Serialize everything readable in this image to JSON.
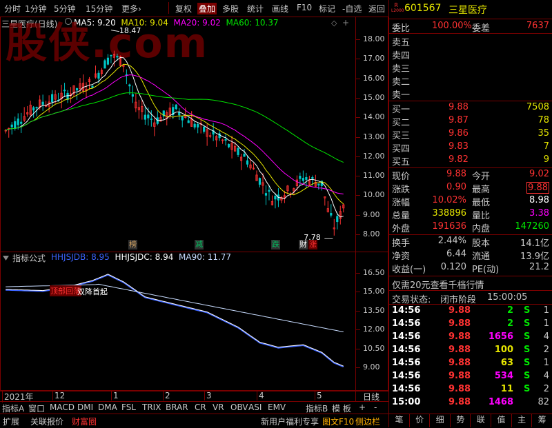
{
  "toolbar": {
    "left": [
      "分时",
      "1分钟",
      "5分钟",
      "15分钟",
      "更多"
    ],
    "more_arrow": "›",
    "right": [
      "复权",
      "叠加",
      "多股",
      "统计",
      "画线",
      "F10",
      "标记",
      "-自选",
      "返回"
    ],
    "active": "叠加"
  },
  "main_chart": {
    "stock_label": "三星医疗(日线)",
    "ma": [
      {
        "label": "MA5: 9.20",
        "color": "#ffffff"
      },
      {
        "label": "MA10: 9.04",
        "color": "#e6e600"
      },
      {
        "label": "MA20: 9.02",
        "color": "#ff00ff"
      },
      {
        "label": "MA60: 10.37",
        "color": "#00e600"
      }
    ],
    "y_ticks": [
      "18.00",
      "17.00",
      "16.00",
      "15.00",
      "14.00",
      "13.00",
      "12.00",
      "11.00",
      "10.00",
      "9.00",
      "8.00"
    ],
    "high_label": "18.47",
    "low_label": "7.78",
    "markers": [
      {
        "text": "榜",
        "color": "#d0a060"
      },
      {
        "text": "减",
        "color": "#00c060"
      },
      {
        "text": "跌",
        "color": "#00c060"
      },
      {
        "text": "财",
        "color": "#ffffff"
      },
      {
        "text": "涨",
        "color": "#ff3232"
      }
    ],
    "watermark": "股侠.com"
  },
  "indicator": {
    "title": "指标公式",
    "items": [
      {
        "label": "HHJSJDB: 8.95",
        "color": "#3c64ff"
      },
      {
        "label": "HHJSJDC: 8.94",
        "color": "#ffffff"
      },
      {
        "label": "MA90: 11.77",
        "color": "#c8dcff"
      }
    ],
    "y_ticks": [
      "16.50",
      "15.00",
      "13.50",
      "12.00",
      "10.50",
      "9.00"
    ],
    "signals": [
      "顶部回落",
      "双降首起"
    ]
  },
  "x_axis": {
    "labels": [
      "2021年",
      "12",
      "1",
      "2",
      "3",
      "4",
      "5"
    ],
    "period": "日线"
  },
  "bottom_tabs": [
    "指标A",
    "窗口",
    "MACD",
    "DMI",
    "DMA",
    "FSL",
    "TRIX",
    "BRAR",
    "CR",
    "VR",
    "OBV",
    "ASI",
    "EMV"
  ],
  "bottom_tabs_right": [
    "指标B",
    "模 板",
    "+",
    "-"
  ],
  "bottom_bar": {
    "left": [
      "扩展",
      "关联报价",
      "财富圈"
    ],
    "right": [
      "新用户福利专享",
      "图文F10",
      "侧边栏"
    ]
  },
  "side_tabs": [
    "笔",
    "价",
    "细",
    "势",
    "联",
    "值",
    "主",
    "筹"
  ],
  "quote": {
    "badge_r": "R",
    "badge_l2": "L2000",
    "code": "601567",
    "name": "三星医疗",
    "weibi_label": "委比",
    "weibi": "100.00%",
    "weicha_label": "委差",
    "weicha": "7637",
    "sell": [
      {
        "label": "卖五"
      },
      {
        "label": "卖四"
      },
      {
        "label": "卖三"
      },
      {
        "label": "卖二"
      },
      {
        "label": "卖一"
      }
    ],
    "buy": [
      {
        "label": "买一",
        "price": "9.88",
        "vol": "7508"
      },
      {
        "label": "买二",
        "price": "9.87",
        "vol": "78"
      },
      {
        "label": "买三",
        "price": "9.86",
        "vol": "35"
      },
      {
        "label": "买四",
        "price": "9.83",
        "vol": "7"
      },
      {
        "label": "买五",
        "price": "9.82",
        "vol": "9"
      }
    ],
    "stats": [
      {
        "l1": "现价",
        "v1": "9.88",
        "c1": "red",
        "l2": "今开",
        "v2": "9.02",
        "c2": "red"
      },
      {
        "l1": "涨跌",
        "v1": "0.90",
        "c1": "red",
        "l2": "最高",
        "v2": "9.88",
        "c2": "red"
      },
      {
        "l1": "涨幅",
        "v1": "10.02%",
        "c1": "red",
        "l2": "最低",
        "v2": "8.98",
        "c2": "wht"
      },
      {
        "l1": "总量",
        "v1": "338896",
        "c1": "yel",
        "l2": "量比",
        "v2": "3.38",
        "c2": "mag"
      },
      {
        "l1": "外盘",
        "v1": "191636",
        "c1": "red",
        "l2": "内盘",
        "v2": "147260",
        "c2": "grn"
      }
    ],
    "fund": [
      {
        "l1": "换手",
        "v1": "2.44%",
        "l2": "股本",
        "v2": "14.1亿"
      },
      {
        "l1": "净资",
        "v1": "6.44",
        "l2": "流通",
        "v2": "13.9亿"
      },
      {
        "l1": "收益(一)",
        "v1": "0.120",
        "l2": "PE(动)",
        "v2": "21.2"
      }
    ],
    "promo": "仅需20元查看千档行情",
    "trade_status_label": "交易状态:",
    "trade_status": "闭市阶段",
    "trade_time": "15:00:05",
    "ticks": [
      {
        "t": "14:56",
        "p": "9.88",
        "v": "2",
        "vc": "grn",
        "s": "S",
        "n": "1"
      },
      {
        "t": "14:56",
        "p": "9.88",
        "v": "2",
        "vc": "grn",
        "s": "S",
        "n": "1"
      },
      {
        "t": "14:56",
        "p": "9.88",
        "v": "1656",
        "vc": "mag",
        "s": "S",
        "n": "4"
      },
      {
        "t": "14:56",
        "p": "9.88",
        "v": "100",
        "vc": "yel",
        "s": "S",
        "n": "2"
      },
      {
        "t": "14:56",
        "p": "9.88",
        "v": "63",
        "vc": "yel",
        "s": "S",
        "n": "1"
      },
      {
        "t": "14:56",
        "p": "9.88",
        "v": "534",
        "vc": "mag",
        "s": "S",
        "n": "4"
      },
      {
        "t": "14:56",
        "p": "9.88",
        "v": "11",
        "vc": "yel",
        "s": "S",
        "n": "2"
      },
      {
        "t": "15:00",
        "p": "9.88",
        "v": "1468",
        "vc": "mag",
        "s": "",
        "n": "82"
      }
    ]
  }
}
